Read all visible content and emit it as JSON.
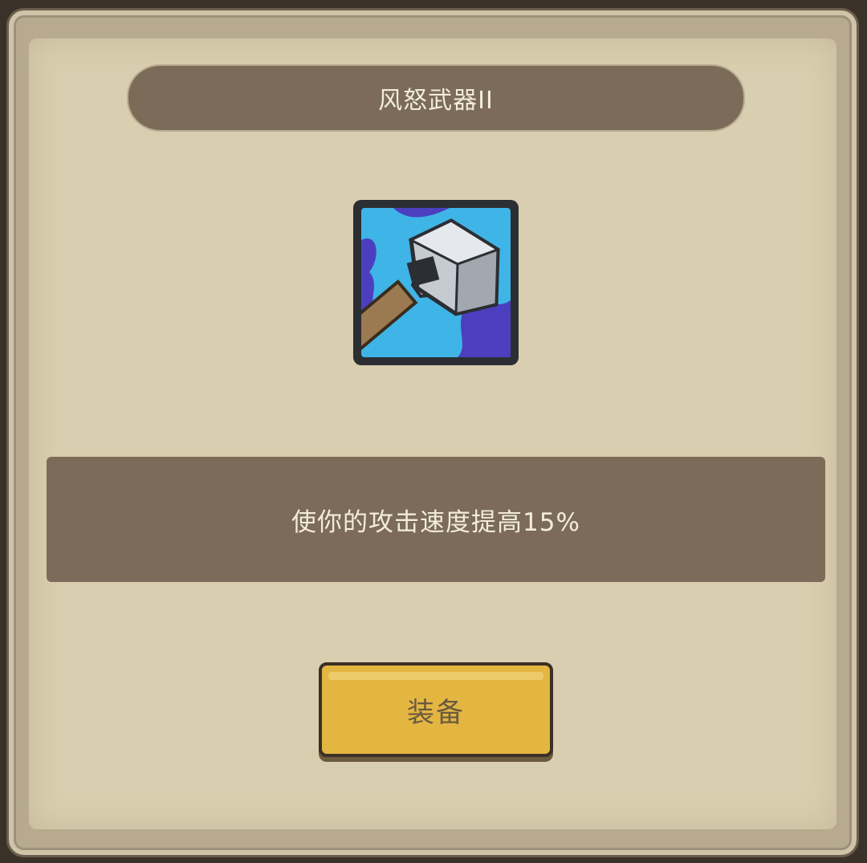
{
  "dialog": {
    "title": "风怒武器II",
    "item_icon": "hammer-icon",
    "description": "使你的攻击速度提高15%",
    "button_label": "装备"
  },
  "colors": {
    "frame": "#b7aa8e",
    "parchment": "#d9ceaf",
    "banner": "#7b6b58",
    "button": "#e3b642",
    "icon_bg": "#3fb4e6"
  }
}
